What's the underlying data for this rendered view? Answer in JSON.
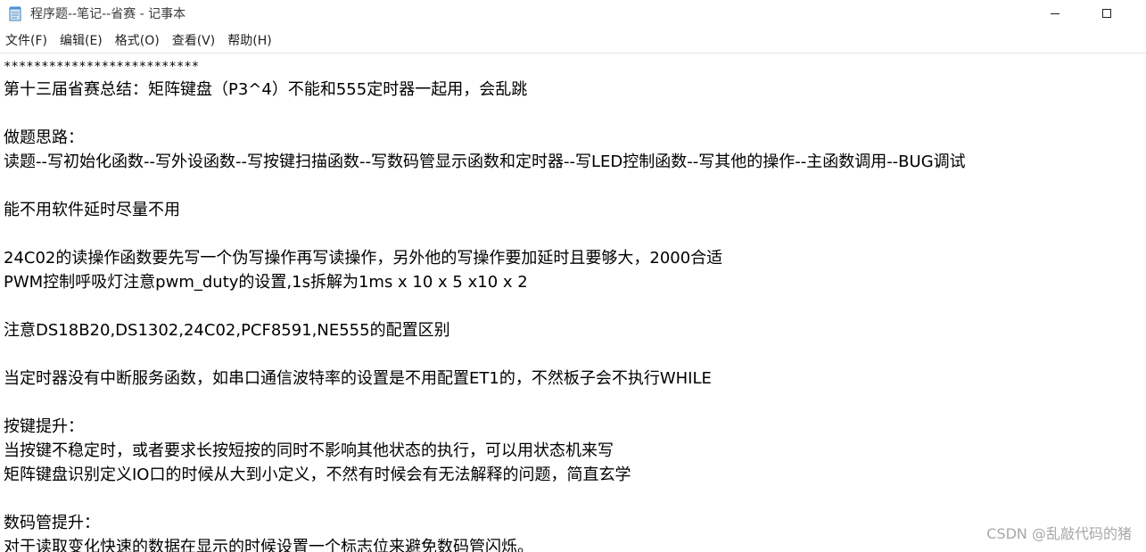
{
  "window": {
    "title": "程序题--笔记--省赛 - 记事本",
    "icon": "notepad-icon"
  },
  "menu": [
    {
      "label": "文件(F)"
    },
    {
      "label": "编辑(E)"
    },
    {
      "label": "格式(O)"
    },
    {
      "label": "查看(V)"
    },
    {
      "label": "帮助(H)"
    }
  ],
  "editor": {
    "lines": [
      "**************************",
      "第十三届省赛总结：矩阵键盘（P3^4）不能和555定时器一起用，会乱跳",
      "",
      "做题思路：",
      "读题--写初始化函数--写外设函数--写按键扫描函数--写数码管显示函数和定时器--写LED控制函数--写其他的操作--主函数调用--BUG调试",
      "",
      "能不用软件延时尽量不用",
      "",
      "24C02的读操作函数要先写一个伪写操作再写读操作，另外他的写操作要加延时且要够大，2000合适",
      "PWM控制呼吸灯注意pwm_duty的设置,1s拆解为1ms x 10 x 5 x10 x 2",
      "",
      "注意DS18B20,DS1302,24C02,PCF8591,NE555的配置区别",
      "",
      "当定时器没有中断服务函数，如串口通信波特率的设置是不用配置ET1的，不然板子会不执行WHILE",
      "",
      "按键提升：",
      "当按键不稳定时，或者要求长按短按的同时不影响其他状态的执行，可以用状态机来写",
      "矩阵键盘识别定义IO口的时候从大到小定义，不然有时候会有无法解释的问题，简直玄学",
      "",
      "数码管提升：",
      "对于读取变化快速的数据在显示的时候设置一个标志位来避免数码管闪烁。"
    ]
  },
  "watermark": "CSDN @乱敲代码的猪"
}
